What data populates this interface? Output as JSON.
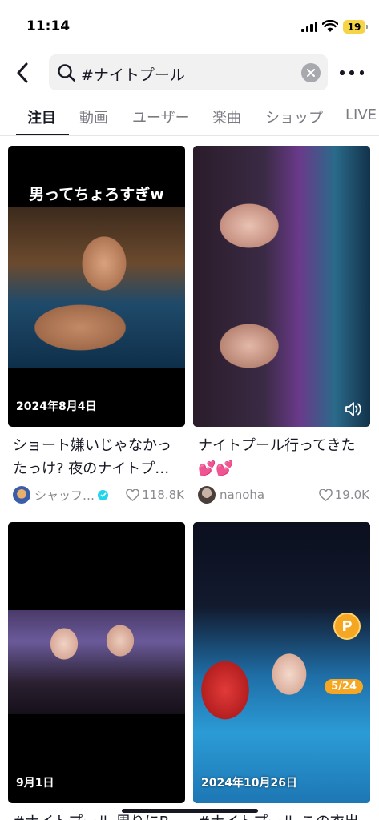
{
  "status_bar": {
    "time": "11:14",
    "battery": "19"
  },
  "search": {
    "query": "#ナイトプール"
  },
  "tabs": [
    {
      "label": "注目",
      "active": true
    },
    {
      "label": "動画"
    },
    {
      "label": "ユーザー"
    },
    {
      "label": "楽曲"
    },
    {
      "label": "ショップ"
    },
    {
      "label": "LIVE"
    }
  ],
  "results": [
    {
      "overlay_text": "男ってちょろすぎw",
      "date": "2024年8月4日",
      "caption": "ショート嫌いじゃなかったっけ? 夜のナイトプ…",
      "author": "シャッフ…",
      "verified": true,
      "likes": "118.8K"
    },
    {
      "date": "",
      "caption": "ナイトプール行ってきた💕💕",
      "author": "nanoha",
      "likes": "19.0K",
      "has_sound_icon": true
    },
    {
      "date": "9月1日",
      "caption": "#ナイトプール 周りにB…"
    },
    {
      "date": "2024年10月26日",
      "badge_p": "P",
      "badge_count": "5/24",
      "caption": "#ナイトプール この衣出…"
    }
  ],
  "colors": {
    "accent_verified": "#20d5ec",
    "badge_orange": "#f5a623"
  }
}
